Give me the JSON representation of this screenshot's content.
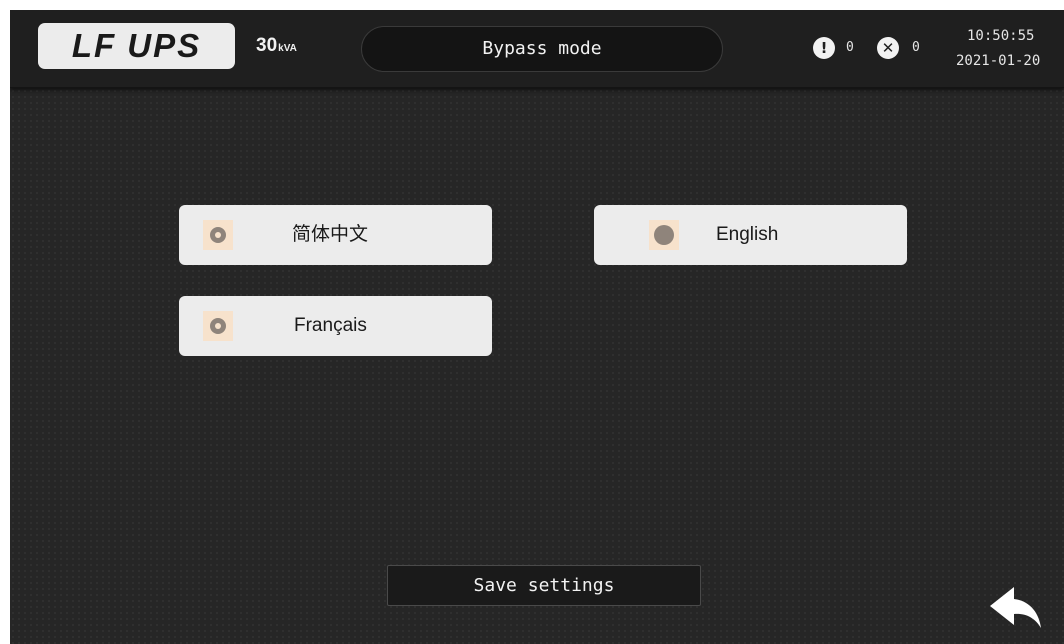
{
  "header": {
    "logo_text": "LF UPS",
    "capacity_value": "30",
    "capacity_unit": "kVA",
    "mode": "Bypass mode",
    "warning_count": "0",
    "fault_count": "0",
    "time": "10:50:55",
    "date": "2021-01-20"
  },
  "languages": [
    {
      "label": "简体中文",
      "selected": false
    },
    {
      "label": "English",
      "selected": true
    },
    {
      "label": "Français",
      "selected": false
    }
  ],
  "save_label": "Save settings",
  "icons": {
    "warning": "exclamation-icon",
    "fault": "x-circle-icon",
    "back": "back-arrow-icon"
  },
  "colors": {
    "background": "#262626",
    "header": "#1f1f1f",
    "button": "#ececec",
    "radio_bg": "#f7e2cc",
    "radio_dot": "#8f847b"
  }
}
